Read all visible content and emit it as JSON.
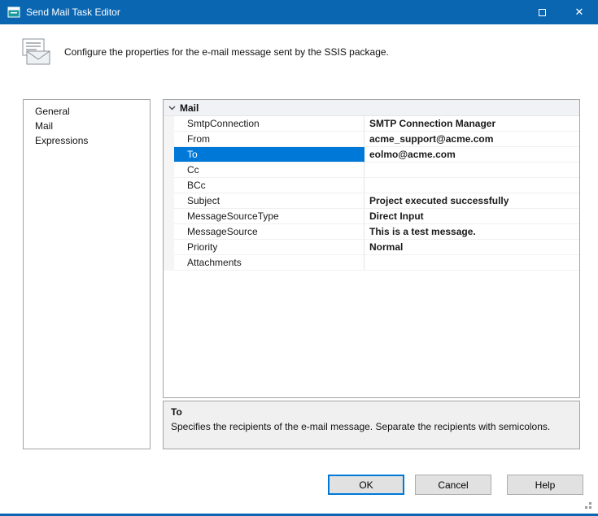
{
  "window": {
    "title": "Send Mail Task Editor",
    "description": "Configure the properties for the e-mail message sent by the SSIS package."
  },
  "sidebar": {
    "items": [
      {
        "label": "General"
      },
      {
        "label": "Mail"
      },
      {
        "label": "Expressions"
      }
    ]
  },
  "property_grid": {
    "category": "Mail",
    "rows": [
      {
        "name": "SmtpConnection",
        "value": "SMTP Connection Manager",
        "selected": false
      },
      {
        "name": "From",
        "value": "acme_support@acme.com",
        "selected": false
      },
      {
        "name": "To",
        "value": "eolmo@acme.com",
        "selected": true
      },
      {
        "name": "Cc",
        "value": "",
        "selected": false
      },
      {
        "name": "BCc",
        "value": "",
        "selected": false
      },
      {
        "name": "Subject",
        "value": "Project executed successfully",
        "selected": false
      },
      {
        "name": "MessageSourceType",
        "value": "Direct Input",
        "selected": false
      },
      {
        "name": "MessageSource",
        "value": "This is a test message.",
        "selected": false
      },
      {
        "name": "Priority",
        "value": "Normal",
        "selected": false
      },
      {
        "name": "Attachments",
        "value": "",
        "selected": false
      }
    ]
  },
  "description_panel": {
    "title": "To",
    "text": "Specifies the recipients of the e-mail message. Separate the recipients with semicolons."
  },
  "buttons": {
    "ok": "OK",
    "cancel": "Cancel",
    "help": "Help"
  },
  "colors": {
    "titlebar": "#0b66b2",
    "selection": "#0078d7",
    "button_face": "#e1e1e1"
  }
}
